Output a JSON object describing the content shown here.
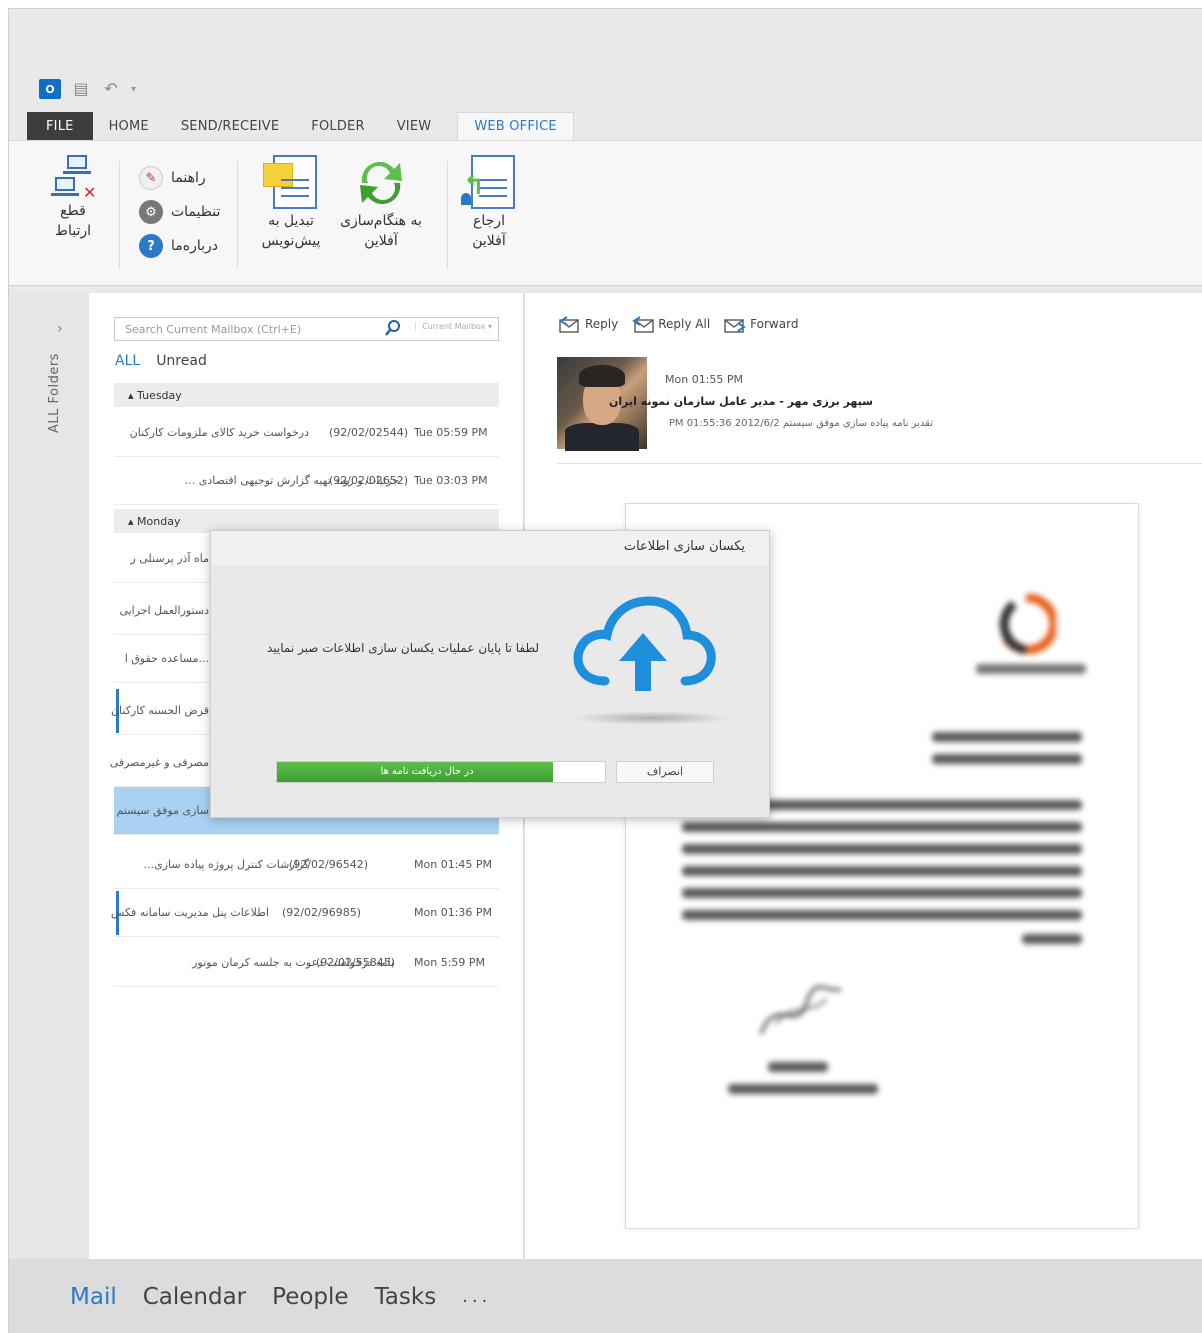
{
  "qat": {
    "app_icon_label": "O"
  },
  "tabs": [
    "FILE",
    "HOME",
    "SEND/RECEIVE",
    "FOLDER",
    "VIEW",
    "WEB OFFICE"
  ],
  "ribbon": {
    "disconnect_label": "قطع ارتباط",
    "guide_label": "راهنما",
    "settings_label": "تنظیمات",
    "about_label": "درباره‌ما",
    "to_draft_label": "تبدیل به پیش‌نویس",
    "sync_label": "به هنگام‌سازی آفلاین",
    "refer_label": "ارجاع آفلاین"
  },
  "sidebar": {
    "chevron": "›",
    "label": "ALL Folders"
  },
  "search": {
    "placeholder": "Search Current Mailbox (Ctrl+E)",
    "scope": "Current Mailbox"
  },
  "filters": {
    "all": "ALL",
    "unread": "Unread"
  },
  "groups": {
    "tuesday": "Tuesday",
    "monday": "Monday"
  },
  "mails": [
    {
      "subject": "درخواست خرید کالای ملزومات کارکنان",
      "number": "(92/02/02544)",
      "date": "Tue 05:59 PM"
    },
    {
      "subject": "جزئیات و روند تهیه گزارش توجیهی اقتصادی ...",
      "number": "(92/02/02652)",
      "date": "Tue 03:03 PM"
    },
    {
      "stub": "ماه آذر پرسنلی ر"
    },
    {
      "stub": "دستورالعمل اجرایی"
    },
    {
      "stub": "...مساعده حقوق ا"
    },
    {
      "stub": "قرض الحسنه کارکنان"
    },
    {
      "stub": "مصرفی و غیرمصرفی"
    },
    {
      "stub": "سازی موفق سیستم"
    },
    {
      "subject": "گزارشات کنترل پروژه پیاده سازی...",
      "number": "(92/02/96542)",
      "date": "Mon 01:45 PM"
    },
    {
      "subject": "اطلاعات پنل مدیریت سامانه فکس",
      "number": "(92/02/96985)",
      "date": "Mon 01:36 PM"
    },
    {
      "subject": "نامه درخواست دعوت به جلسه کرمان موتور",
      "number": "(92/02/55845)",
      "date": "Mon 5:59 PM"
    }
  ],
  "reading": {
    "reply": "Reply",
    "reply_all": "Reply All",
    "forward": "Forward",
    "time": "Mon 01:55 PM",
    "from": "سپهر برزی مهر - مدیر عامل سازمان نمونه ایران",
    "subtitle": "تقدیر نامه پیاده سازی موفق سیستم  2012/6/2  01:55:36  PM"
  },
  "modal": {
    "title": "یکسان سازی اطلاعات",
    "message": "لطفا تا پایان عملیات یکسان سازی اطلاعات صبر نمایید",
    "progress_text": "در حال دریافت نامه ها",
    "progress_fraction": 0.84,
    "cancel": "انصراف"
  },
  "nav": [
    "Mail",
    "Calendar",
    "People",
    "Tasks",
    "..."
  ],
  "colors": {
    "accent": "#2a7ac7",
    "progress": "#4cae3e",
    "danger": "#d9262c"
  }
}
